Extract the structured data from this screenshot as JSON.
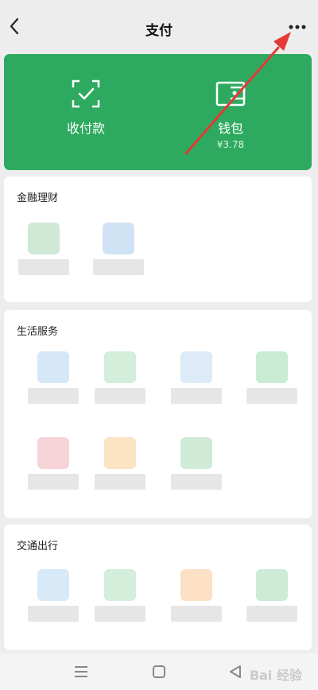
{
  "header": {
    "title": "支付"
  },
  "hero": {
    "left": {
      "label": "收付款"
    },
    "right": {
      "label": "钱包",
      "balance": "¥3.78"
    }
  },
  "sections": {
    "finance": {
      "title": "金融理财"
    },
    "life": {
      "title": "生活服务"
    },
    "transport": {
      "title": "交通出行"
    }
  },
  "watermark": "Bai 经验",
  "colors": {
    "accent": "#2daa5f",
    "arrow": "#e53935"
  }
}
